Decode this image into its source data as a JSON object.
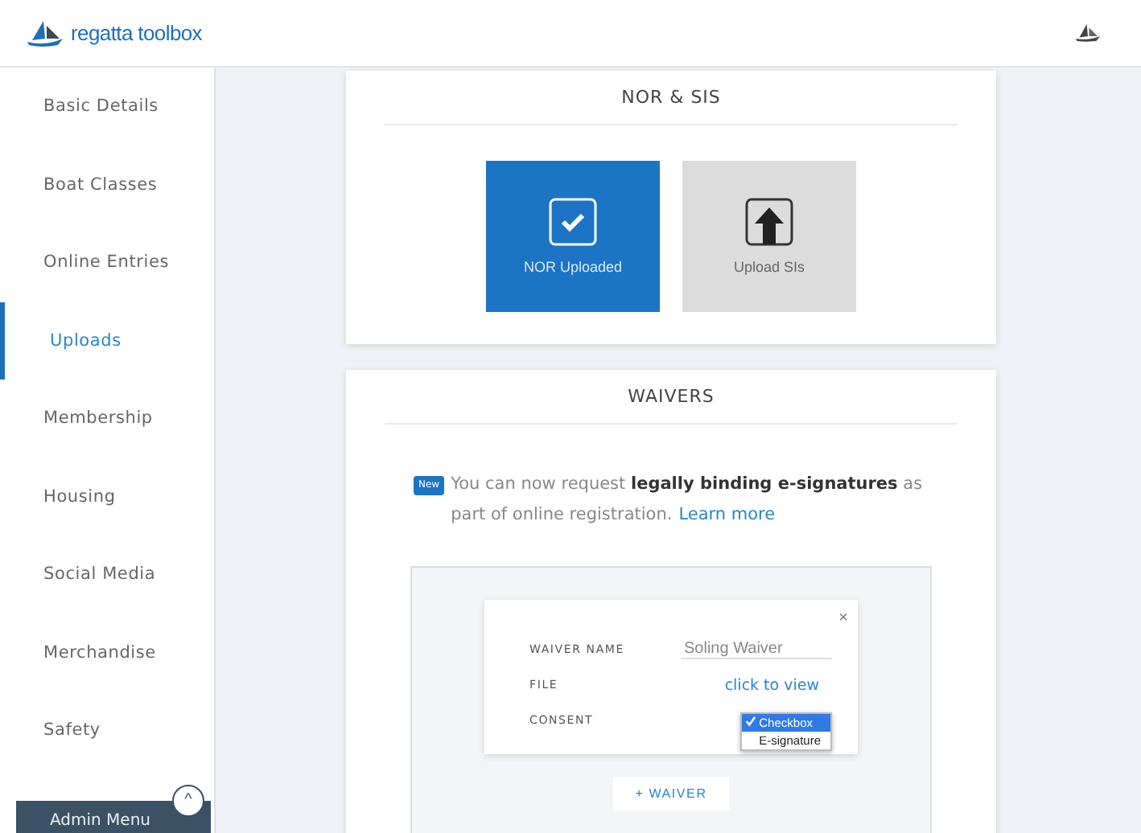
{
  "header": {
    "brand": "regatta toolbox"
  },
  "sidebar": {
    "items": [
      {
        "label": "Basic Details",
        "selected": false
      },
      {
        "label": "Boat Classes",
        "selected": false
      },
      {
        "label": "Online Entries",
        "selected": false
      },
      {
        "label": "Uploads",
        "selected": true
      },
      {
        "label": "Membership",
        "selected": false
      },
      {
        "label": "Housing",
        "selected": false
      },
      {
        "label": "Social Media",
        "selected": false
      },
      {
        "label": "Merchandise",
        "selected": false
      },
      {
        "label": "Safety",
        "selected": false
      }
    ],
    "admin_menu": {
      "label": "Admin Menu",
      "toggle": "^"
    }
  },
  "nor_sis": {
    "title": "NOR & SIS",
    "tiles": [
      {
        "label": "NOR Uploaded",
        "uploaded": true
      },
      {
        "label": "Upload SIs",
        "uploaded": false
      }
    ]
  },
  "waivers": {
    "title": "WAIVERS",
    "badge": "New",
    "notice": "You can now request **legally binding e-signatures** as part of online registration.",
    "learn_more": "Learn more",
    "waiver": {
      "close": "×",
      "name_label": "WAIVER NAME",
      "name_value": "Soling Waiver",
      "file_label": "FILE",
      "file_link": "click to view",
      "consent_label": "CONSENT",
      "consent_options": [
        {
          "label": "Checkbox",
          "selected": true
        },
        {
          "label": "E-signature",
          "selected": false
        }
      ]
    },
    "add_button": "+ WAIVER"
  }
}
